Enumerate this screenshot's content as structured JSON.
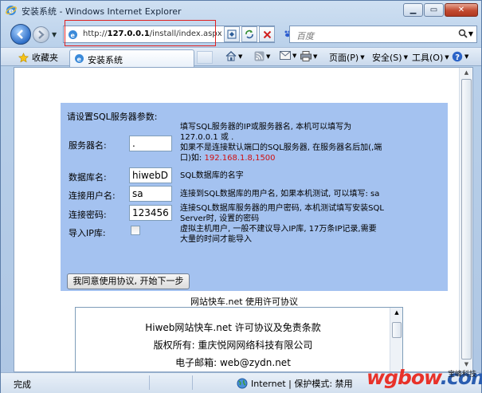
{
  "window": {
    "title": "安装系统 - Windows Internet Explorer"
  },
  "address": {
    "prefix": "http://",
    "host": "127.0.0.1",
    "path": "/install/index.aspx"
  },
  "search": {
    "placeholder": "百度"
  },
  "favorites_label": "收藏夹",
  "tab_title": "安装系统",
  "commands": {
    "page": "页面(P)",
    "safety": "安全(S)",
    "tools": "工具(O)"
  },
  "form": {
    "heading": "请设置SQL服务器参数:",
    "server": {
      "label": "服务器名:",
      "value": ".",
      "desc_line1": "填写SQL服务器的IP或服务器名, 本机可以填写为",
      "desc_line2": "127.0.0.1 或 .",
      "desc_line3": "如果不是连接默认端口的SQL服务器, 在服务器名后加(,端",
      "desc_line4_prefix": "口)如:",
      "desc_line4_example": "192.168.1.8,1500"
    },
    "database": {
      "label": "数据库名:",
      "value": "hiwebDB",
      "desc": "SQL数据库的名字"
    },
    "username": {
      "label": "连接用户名:",
      "value": "sa",
      "desc": "连接到SQL数据库的用户名, 如果本机测试, 可以填写: sa"
    },
    "password": {
      "label": "连接密码:",
      "value": "123456",
      "desc_line1": "连接SQL数据库服务器的用户密码, 本机测试填写安装SQL",
      "desc_line2": "Server时, 设置的密码"
    },
    "import_ip": {
      "label": "导入IP库:",
      "checked": false,
      "desc_line1": "虚拟主机用户, 一般不建议导入IP库, 17万条IP记录,需要",
      "desc_line2": "大量的时间才能导入"
    },
    "agree_button": "我同意使用协议, 开始下一步"
  },
  "license": {
    "title": "网站快车.net 使用许可协议",
    "lines": [
      "Hiweb网站快车.net 许可协议及免责条款",
      "版权所有: 重庆悦网网络科技有限公司",
      "电子邮箱: web@zydn.net"
    ]
  },
  "status": {
    "done": "完成",
    "zone": "Internet | 保护模式: 禁用"
  },
  "watermark": {
    "text_a": "wgbow",
    "text_b": ".com",
    "cn": "宝峰科技"
  },
  "colors": {
    "panel": "#a4c2f0",
    "red_example": "#d01010",
    "highlight_box": "#e02020"
  }
}
